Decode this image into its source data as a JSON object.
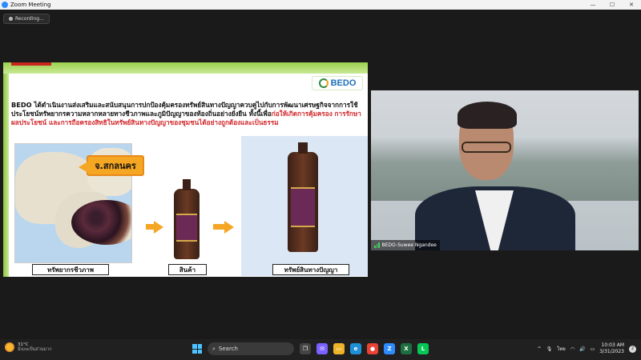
{
  "window": {
    "title": "Zoom Meeting",
    "minimize": "—",
    "maximize": "☐",
    "close": "✕"
  },
  "recording": {
    "label": "Recording..."
  },
  "slide": {
    "logo_text": "BEDO",
    "para_black": "BEDO ได้ดำเนินงานส่งเสริมและสนับสนุนการปกป้องคุ้มครองทรัพย์สินทางปัญญาควบคู่ไปกับการพัฒนาเศรษฐกิจจากการใช้ประโยชน์ทรัพยากรความหลากหลายทางชีวภาพและภูมิปัญญาของท้องถิ่นอย่างยั่งยืน ทั้งนี้เพื่อ",
    "para_red": "ก่อให้เกิดการคุ้มครอง การรักษาผลประโยชน์ และการถือครองสิทธิในทรัพย์สินทางปัญญาของชุมชนได้อย่างถูกต้องและเป็นธรรม",
    "map_label": "จ.สกลนคร",
    "caption1": "ทรัพยากรชีวภาพ",
    "caption2": "สินค้า",
    "caption3": "ทรัพย์สินทางปัญญา"
  },
  "video": {
    "participant_name": "BEDO-Suwee Ngandee"
  },
  "taskbar": {
    "weather_temp": "31°C",
    "weather_desc": "มีเมฆเป็นส่วนมาก",
    "search_label": "Search",
    "lang": "ไทย",
    "time": "10:03 AM",
    "date": "3/31/2023",
    "notifications": "2"
  },
  "colors": {
    "zoom_blue": "#2d8cff",
    "bedo_green": "#8cc63f",
    "accent_orange": "#f5a623",
    "highlight_red": "#d1262b"
  }
}
